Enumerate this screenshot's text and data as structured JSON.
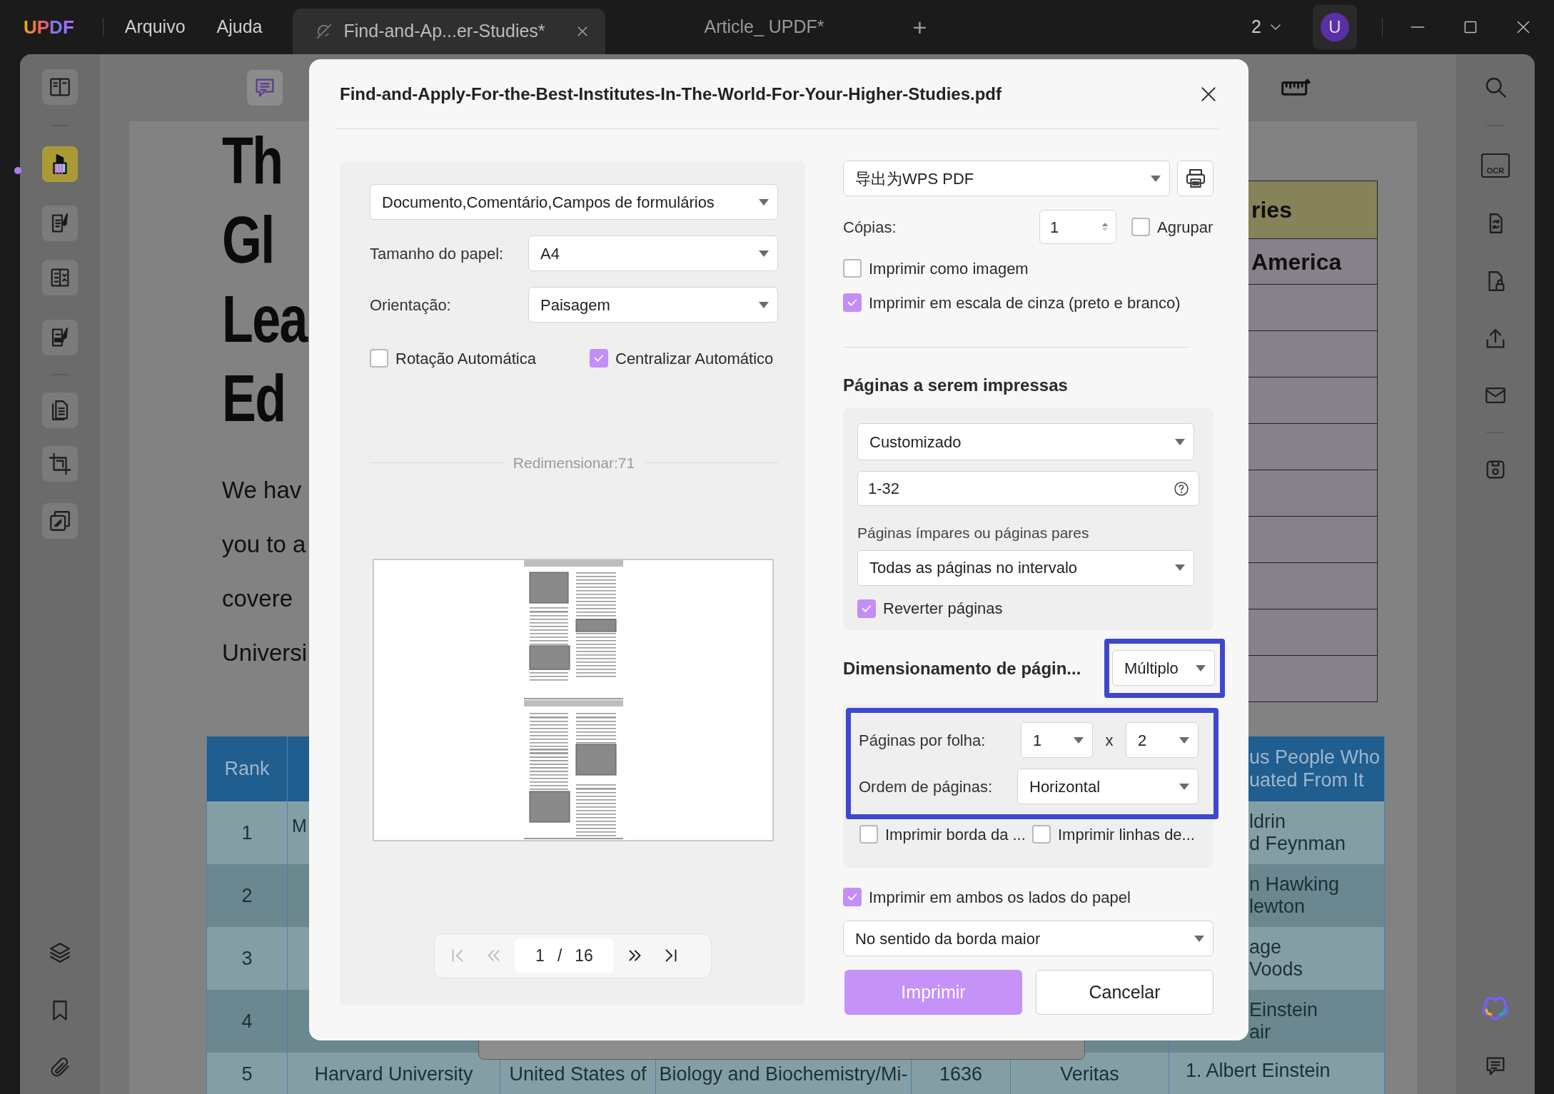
{
  "title_bar": {
    "logo": "UPDF",
    "menus": [
      "Arquivo",
      "Ajuda"
    ],
    "tabs": [
      {
        "label": "Find-and-Ap...er-Studies*",
        "selected": true
      },
      {
        "label": "Article_ UPDF*",
        "selected": false
      }
    ],
    "new_tab": "+",
    "window_count": "2",
    "avatar": "U"
  },
  "left_toolbar": {
    "tools": [
      {
        "selected": false
      },
      {
        "selected": true
      },
      {
        "selected": false
      },
      {
        "selected": false
      },
      {
        "selected": false
      },
      {
        "selected": false
      },
      {
        "selected": false
      },
      {
        "selected": false
      },
      {
        "selected": false
      },
      {
        "selected": false
      },
      {
        "selected": false
      }
    ]
  },
  "top_toolbar": {
    "tools": [
      {
        "selected": true
      },
      {
        "selected": false
      }
    ]
  },
  "right_toolbar": {
    "ocr": "OCR"
  },
  "document": {
    "headline": [
      "Th",
      "Gl",
      "Lea",
      "Ed"
    ],
    "paragraph": [
      "We  hav",
      "you to a",
      "covere",
      "Universi"
    ],
    "side_table": {
      "header": "ries",
      "first_row": "America"
    },
    "ranking_table": {
      "header": {
        "rank": "Rank",
        "column_7": [
          "us People Who",
          "uated From It"
        ]
      },
      "rows": [
        {
          "rank": "1",
          "column_2": "M",
          "column_7": [
            "ldrin",
            "d Feynman"
          ]
        },
        {
          "rank": "2",
          "column_7": [
            "n Hawking",
            "lewton"
          ]
        },
        {
          "rank": "3",
          "column_7": [
            "age",
            "Voods"
          ]
        },
        {
          "rank": "4",
          "column_7": [
            "Einstein",
            "air"
          ]
        },
        {
          "rank": "5",
          "column_2": "Harvard University",
          "column_3": "United States of",
          "column_4": "Biology and Biochemistry/Mi-",
          "column_5": "1636",
          "column_6": "Veritas",
          "column_7": [
            "1. Albert Einstein"
          ]
        }
      ]
    }
  },
  "print_dialog": {
    "title": "Find-and-Apply-For-the-Best-Institutes-In-The-World-For-Your-Higher-Studies.pdf",
    "content_select": "Documento,Comentário,Campos de formulários",
    "paper_size": {
      "label": "Tamanho do papel:",
      "value": "A4"
    },
    "orientation": {
      "label": "Orientação:",
      "value": "Paisagem"
    },
    "auto_options": [
      {
        "label": "Rotação Automática",
        "checked": false
      },
      {
        "label": "Centralizar Automático",
        "checked": true
      }
    ],
    "scale_label": "Redimensionar:71",
    "pager": {
      "page": "1",
      "separator": "/",
      "total": "16",
      "nav": [
        {
          "disabled": true
        },
        {
          "disabled": true
        },
        {
          "disabled": false
        },
        {
          "disabled": false
        }
      ]
    },
    "printer": "导出为WPS PDF",
    "copies": {
      "label": "Cópias:",
      "value": "1"
    },
    "collate": {
      "label": "Agrupar",
      "checked": false
    },
    "print_options": [
      {
        "label": "Imprimir como imagem",
        "checked": false
      },
      {
        "label": "Imprimir em escala de cinza (preto e branco)",
        "checked": true
      }
    ],
    "pages_section": {
      "title": "Páginas a serem impressas",
      "range_mode": "Customizado",
      "range": "1-32",
      "subset_label": "Páginas ímpares ou páginas pares",
      "subset": "Todas as páginas no intervalo",
      "reverse": {
        "label": "Reverter páginas",
        "checked": true
      }
    },
    "sizing": {
      "title": "Dimensionamento de págin...",
      "mode": "Múltiplo",
      "highlighted": true,
      "pages_per_sheet": {
        "label": "Páginas por folha:",
        "columns": "1",
        "times": "x",
        "rows": "2"
      },
      "order": {
        "label": "Ordem de páginas:",
        "value": "Horizontal"
      },
      "options": [
        {
          "label": "Imprimir borda da ...",
          "checked": false
        },
        {
          "label": "Imprimir linhas de...",
          "checked": false
        }
      ]
    },
    "duplex": {
      "label": "Imprimir em ambos os lados do papel",
      "checked": true,
      "mode": "No sentido da borda maior"
    },
    "buttons": [
      {
        "label": "Imprimir",
        "kind": "primary"
      },
      {
        "label": "Cancelar",
        "kind": "secondary"
      }
    ]
  }
}
